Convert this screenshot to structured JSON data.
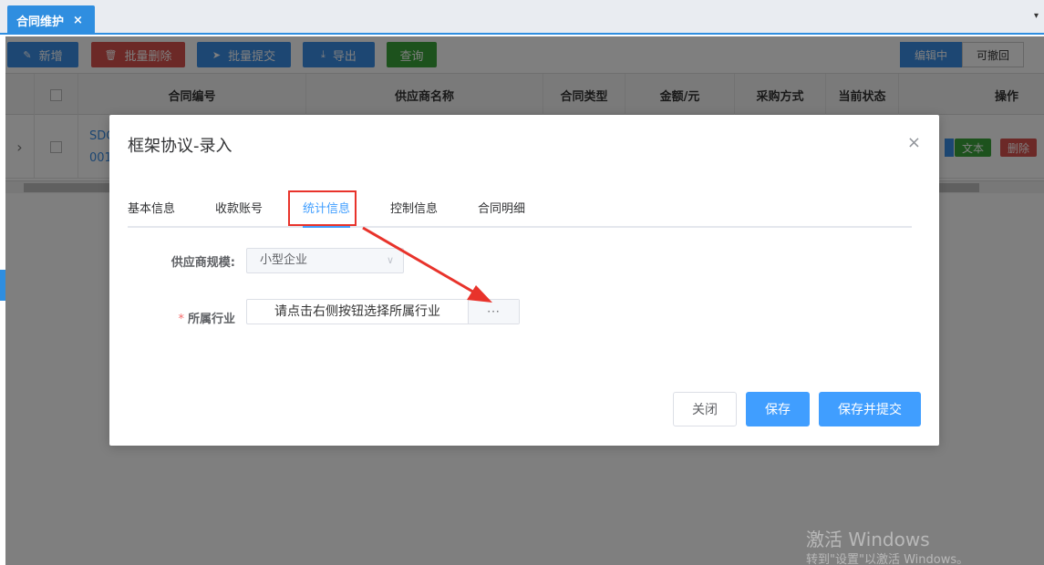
{
  "tab": {
    "label": "合同维护",
    "close": "×",
    "dropdown": "▾"
  },
  "toolbar": {
    "add": "新增",
    "batch_delete": "批量删除",
    "batch_submit": "批量提交",
    "export": "导出",
    "query": "查询",
    "seg_editing": "编辑中",
    "seg_revocable": "可撤回"
  },
  "grid": {
    "columns": [
      "合同编号",
      "供应商名称",
      "合同类型",
      "金额/元",
      "采购方式",
      "当前状态",
      "操作"
    ],
    "row": {
      "code_line1": "SDC",
      "code_line2": "001",
      "expand": "›",
      "action_text": "文本",
      "action_delete": "删除"
    }
  },
  "dialog": {
    "title": "框架协议-录入",
    "close": "×",
    "tabs": [
      "基本信息",
      "收款账号",
      "统计信息",
      "控制信息",
      "合同明细"
    ],
    "active_tab": 2,
    "supplier_scale_label": "供应商规模:",
    "supplier_scale_value": "小型企业",
    "select_arrow": "∨",
    "industry_required": "*",
    "industry_label": "所属行业",
    "industry_placeholder": "请点击右侧按钮选择所属行业",
    "industry_button": "···",
    "buttons": {
      "close": "关闭",
      "save": "保存",
      "save_submit": "保存并提交"
    }
  },
  "watermark": {
    "line1": "激活 Windows",
    "line2": "转到\"设置\"以激活 Windows。"
  },
  "colors": {
    "primary": "#409eff",
    "tab_blue": "#2f8ee0",
    "danger": "#d9534f",
    "success": "#3aa53a",
    "highlight": "#e8332b"
  }
}
